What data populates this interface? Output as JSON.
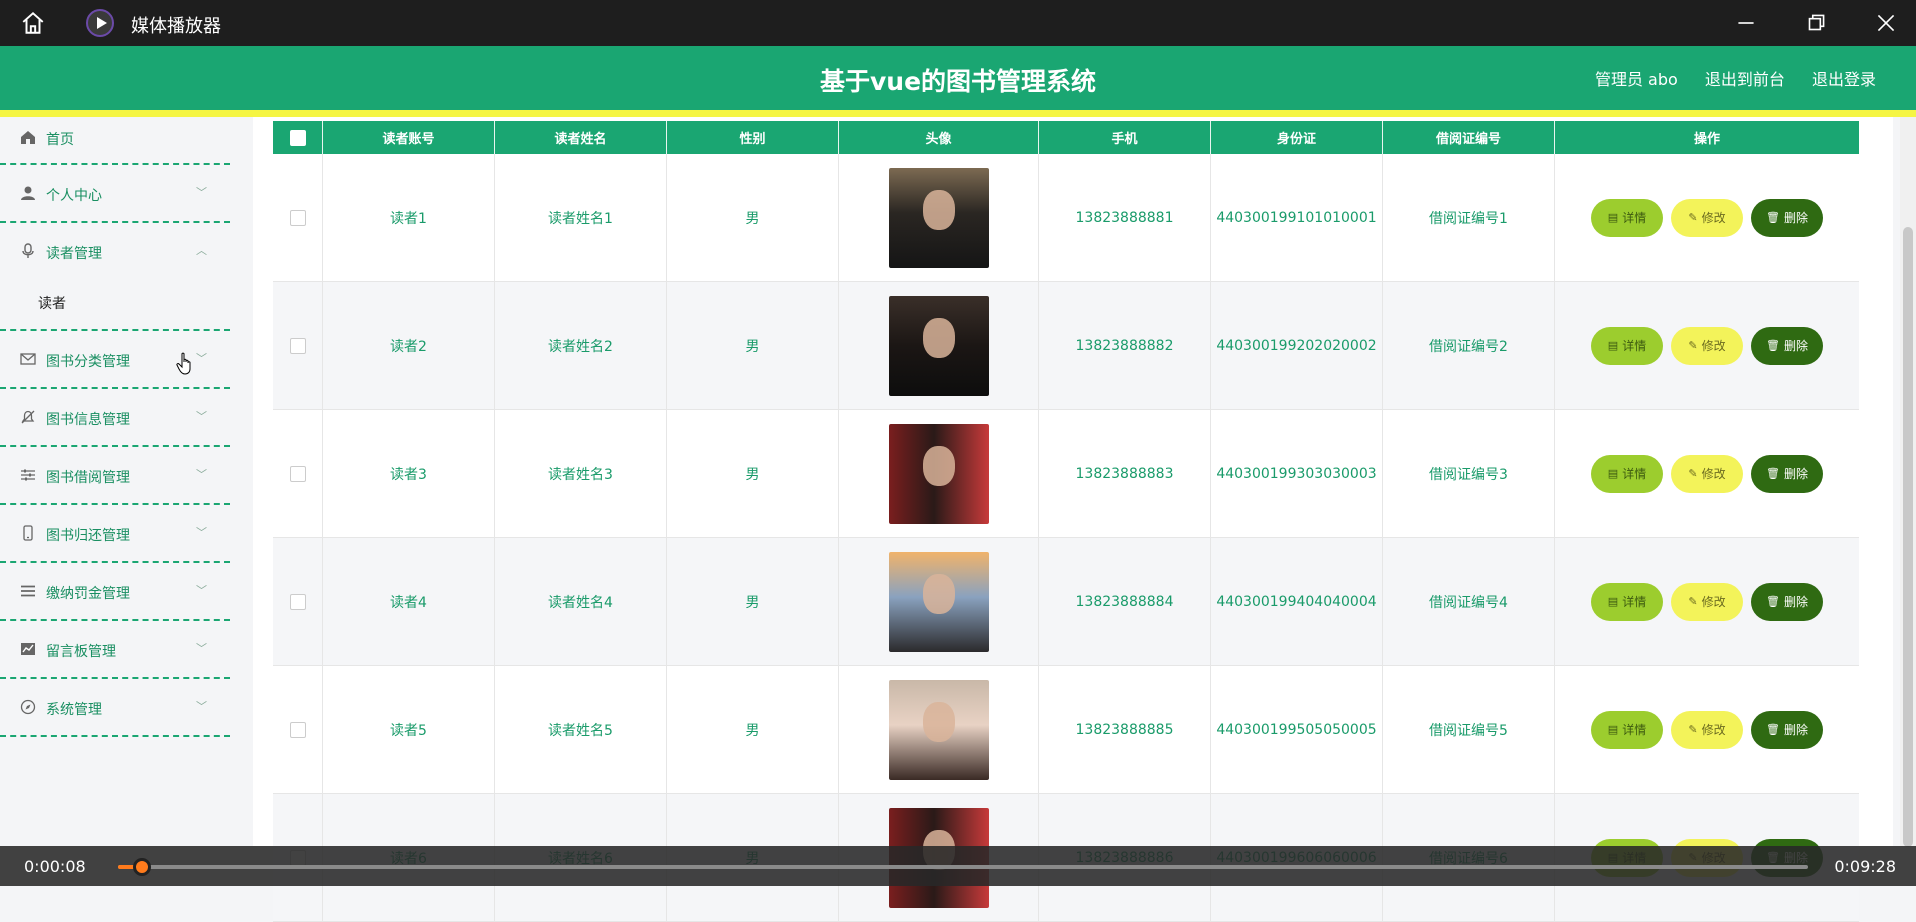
{
  "player": {
    "title": "媒体播放器",
    "time_current": "0:00:08",
    "time_total": "0:09:28",
    "progress": 0.014
  },
  "header": {
    "title": "基于vue的图书管理系统",
    "admin": "管理员 abo",
    "exit_front": "退出到前台",
    "logout": "退出登录"
  },
  "sidebar": {
    "items": [
      {
        "label": "首页",
        "icon": "home-icon"
      },
      {
        "label": "个人中心",
        "icon": "user-icon"
      },
      {
        "label": "读者管理",
        "icon": "mic-icon"
      },
      {
        "label": "图书分类管理",
        "icon": "mail-icon"
      },
      {
        "label": "图书信息管理",
        "icon": "bell-off-icon"
      },
      {
        "label": "图书借阅管理",
        "icon": "sliders-icon"
      },
      {
        "label": "图书归还管理",
        "icon": "phone-icon"
      },
      {
        "label": "缴纳罚金管理",
        "icon": "menu-icon"
      },
      {
        "label": "留言板管理",
        "icon": "chart-icon"
      },
      {
        "label": "系统管理",
        "icon": "compass-icon"
      }
    ],
    "sub_reader": "读者"
  },
  "table": {
    "headers": [
      "读者账号",
      "读者姓名",
      "性别",
      "头像",
      "手机",
      "身份证",
      "借阅证编号",
      "操作"
    ],
    "actions": {
      "detail": "详情",
      "edit": "修改",
      "delete": "删除"
    },
    "rows": [
      {
        "account": "读者1",
        "name": "读者姓名1",
        "gender": "男",
        "phone": "13823888881",
        "id_card": "440300199101010001",
        "card_no": "借阅证编号1"
      },
      {
        "account": "读者2",
        "name": "读者姓名2",
        "gender": "男",
        "phone": "13823888882",
        "id_card": "440300199202020002",
        "card_no": "借阅证编号2"
      },
      {
        "account": "读者3",
        "name": "读者姓名3",
        "gender": "男",
        "phone": "13823888883",
        "id_card": "440300199303030003",
        "card_no": "借阅证编号3"
      },
      {
        "account": "读者4",
        "name": "读者姓名4",
        "gender": "男",
        "phone": "13823888884",
        "id_card": "440300199404040004",
        "card_no": "借阅证编号4"
      },
      {
        "account": "读者5",
        "name": "读者姓名5",
        "gender": "男",
        "phone": "13823888885",
        "id_card": "440300199505050005",
        "card_no": "借阅证编号5"
      },
      {
        "account": "读者6",
        "name": "读者姓名6",
        "gender": "男",
        "phone": "13823888886",
        "id_card": "440300199606060006",
        "card_no": "借阅证编号6"
      }
    ]
  }
}
